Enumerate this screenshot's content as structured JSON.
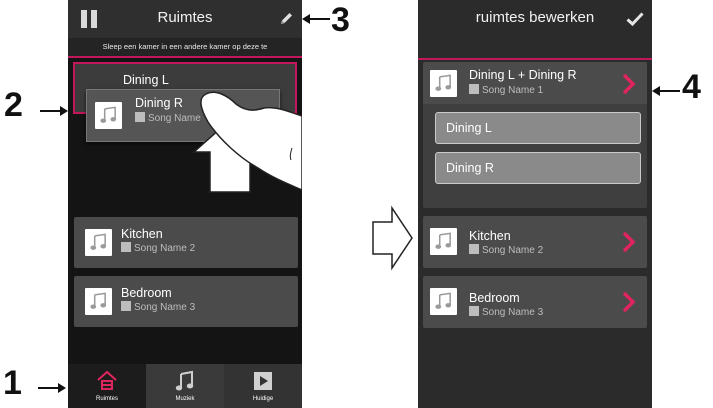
{
  "left_screen": {
    "title": "Ruimtes",
    "hint": "Sleep een kamer in een andere kamer op deze te",
    "drop_target_name": "Dining L",
    "dragged_room": {
      "name": "Dining R",
      "song": "Song Name"
    },
    "rooms": [
      {
        "name": "Kitchen",
        "song": "Song Name 2"
      },
      {
        "name": "Bedroom",
        "song": "Song Name 3"
      }
    ],
    "tabs": [
      {
        "label": "Ruimtes",
        "icon": "house-speaker-icon",
        "active": true
      },
      {
        "label": "Muziek",
        "icon": "music-note-icon",
        "active": false
      },
      {
        "label": "Huidige",
        "icon": "play-icon",
        "active": false
      }
    ]
  },
  "right_screen": {
    "title": "ruimtes bewerken",
    "group": {
      "name": "Dining L + Dining R",
      "song": "Song Name 1",
      "members": [
        "Dining L",
        "Dining R"
      ]
    },
    "rooms": [
      {
        "name": "Kitchen",
        "song": "Song Name 2"
      },
      {
        "name": "Bedroom",
        "song": "Song Name 3"
      }
    ]
  },
  "callouts": {
    "c1": "1",
    "c2": "2",
    "c3": "3",
    "c4": "4"
  },
  "colors": {
    "accent": "#c2185b",
    "background": "#141414",
    "tile": "#4b4b4b",
    "topbar": "#2f2f2f"
  }
}
